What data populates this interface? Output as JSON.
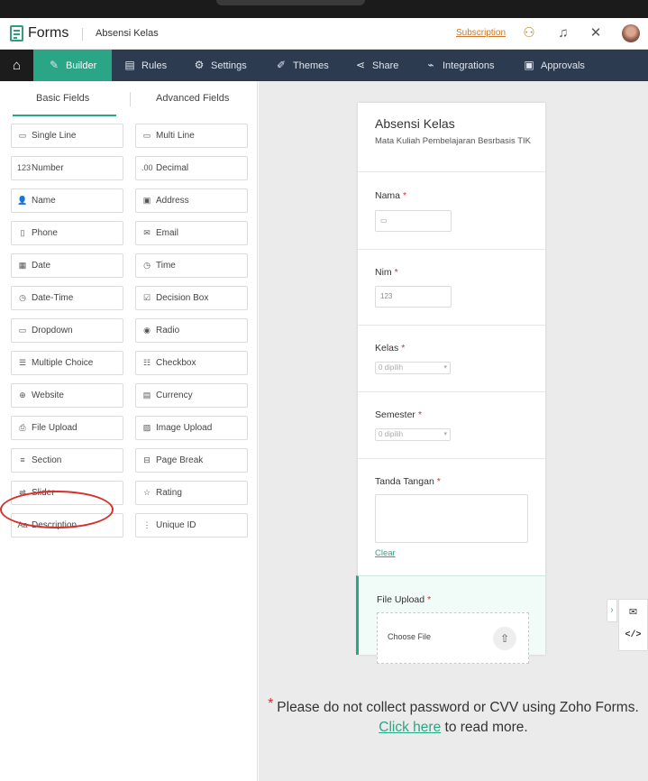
{
  "header": {
    "app_name": "Forms",
    "form_title": "Absensi Kelas",
    "subscription_label": "Subscription"
  },
  "nav": {
    "items": [
      {
        "label": "Builder",
        "icon": "builder-icon"
      },
      {
        "label": "Rules",
        "icon": "rules-icon"
      },
      {
        "label": "Settings",
        "icon": "gear-icon"
      },
      {
        "label": "Themes",
        "icon": "brush-icon"
      },
      {
        "label": "Share",
        "icon": "share-icon"
      },
      {
        "label": "Integrations",
        "icon": "plug-icon"
      },
      {
        "label": "Approvals",
        "icon": "approvals-icon"
      }
    ],
    "active": "Builder"
  },
  "left_panel": {
    "tabs": [
      "Basic Fields",
      "Advanced Fields"
    ],
    "active_tab": "Basic Fields",
    "fields_left": [
      {
        "label": "Single Line",
        "icon": "▭"
      },
      {
        "label": "Number",
        "icon": "123"
      },
      {
        "label": "Name",
        "icon": "👤"
      },
      {
        "label": "Phone",
        "icon": "▯"
      },
      {
        "label": "Date",
        "icon": "▦"
      },
      {
        "label": "Date-Time",
        "icon": "◷"
      },
      {
        "label": "Dropdown",
        "icon": "▭"
      },
      {
        "label": "Multiple Choice",
        "icon": "☰"
      },
      {
        "label": "Website",
        "icon": "⊕"
      },
      {
        "label": "File Upload",
        "icon": "⎙"
      },
      {
        "label": "Section",
        "icon": "≡"
      },
      {
        "label": "Slider",
        "icon": "⇌"
      },
      {
        "label": "Description",
        "icon": "Aa"
      }
    ],
    "fields_right": [
      {
        "label": "Multi Line",
        "icon": "▭"
      },
      {
        "label": "Decimal",
        "icon": ".00"
      },
      {
        "label": "Address",
        "icon": "▣"
      },
      {
        "label": "Email",
        "icon": "✉"
      },
      {
        "label": "Time",
        "icon": "◷"
      },
      {
        "label": "Decision Box",
        "icon": "☑"
      },
      {
        "label": "Radio",
        "icon": "◉"
      },
      {
        "label": "Checkbox",
        "icon": "☷"
      },
      {
        "label": "Currency",
        "icon": "▤"
      },
      {
        "label": "Image Upload",
        "icon": "▨"
      },
      {
        "label": "Page Break",
        "icon": "⊟"
      },
      {
        "label": "Rating",
        "icon": "☆"
      },
      {
        "label": "Unique ID",
        "icon": "⋮"
      }
    ]
  },
  "form": {
    "title": "Absensi Kelas",
    "subtitle": "Mata Kuliah Pembelajaran Besrbasis TIK",
    "fields": {
      "nama": {
        "label": "Nama",
        "input_hint": "▭"
      },
      "nim": {
        "label": "Nim",
        "input_hint": "123"
      },
      "kelas": {
        "label": "Kelas",
        "select_value": "0 dipilih"
      },
      "semester": {
        "label": "Semester",
        "select_value": "0 dipilih"
      },
      "tanda_tangan": {
        "label": "Tanda Tangan",
        "clear_label": "Clear"
      },
      "file_upload": {
        "label": "File Upload",
        "choose_label": "Choose File"
      }
    },
    "required_mark": "*"
  },
  "notice": {
    "asterisk": "*",
    "text_before": "Please do not collect password or CVV using Zoho Forms.",
    "link_text": "Click here",
    "text_after": "to read more."
  },
  "colors": {
    "accent": "#2aa585",
    "nav_bg": "#2d3b50",
    "required": "#d7302b",
    "highlight_oval": "#d7302b"
  }
}
